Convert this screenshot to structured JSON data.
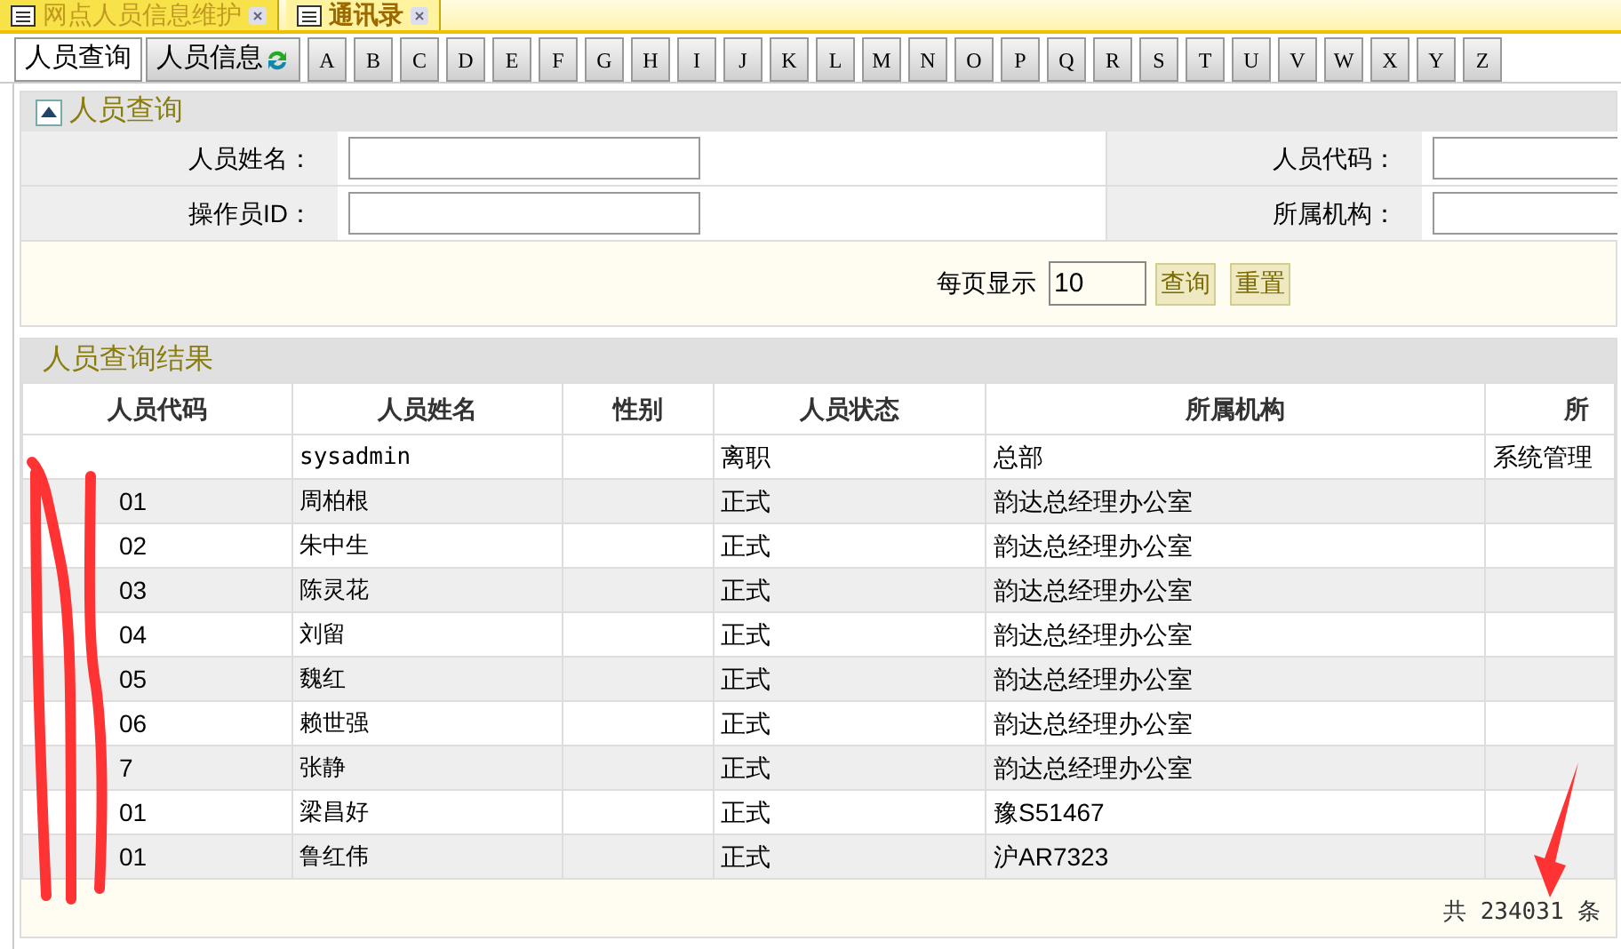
{
  "top_tabs": [
    {
      "label": "网点人员信息维护",
      "selected": false
    },
    {
      "label": "通讯录",
      "selected": true
    }
  ],
  "sub_tabs": [
    {
      "label": "人员查询",
      "selected": true,
      "kind": "text"
    },
    {
      "label": "人员信息",
      "selected": false,
      "kind": "refresh"
    }
  ],
  "letters": [
    "A",
    "B",
    "C",
    "D",
    "E",
    "F",
    "G",
    "H",
    "I",
    "J",
    "K",
    "L",
    "M",
    "N",
    "O",
    "P",
    "Q",
    "R",
    "S",
    "T",
    "U",
    "V",
    "W",
    "X",
    "Y",
    "Z"
  ],
  "query_panel": {
    "title": "人员查询",
    "fields": [
      {
        "label": "人员姓名："
      },
      {
        "label": "人员代码："
      },
      {
        "label": "操作员ID："
      },
      {
        "label": "所属机构："
      }
    ],
    "page_size_label": "每页显示",
    "page_size": "10",
    "buttons": [
      "查询",
      "重置"
    ]
  },
  "results": {
    "title": "人员查询结果",
    "columns": [
      "人员代码",
      "人员姓名",
      "性别",
      "人员状态",
      "所属机构",
      "所"
    ],
    "rows": [
      [
        "",
        "sysadmin",
        "",
        "离职",
        "总部",
        "系统管理"
      ],
      [
        "01",
        "周柏根",
        "",
        "正式",
        "韵达总经理办公室",
        ""
      ],
      [
        "02",
        "朱中生",
        "",
        "正式",
        "韵达总经理办公室",
        ""
      ],
      [
        "03",
        "陈灵花",
        "",
        "正式",
        "韵达总经理办公室",
        ""
      ],
      [
        "04",
        "刘留",
        "",
        "正式",
        "韵达总经理办公室",
        ""
      ],
      [
        "05",
        "魏红",
        "",
        "正式",
        "韵达总经理办公室",
        ""
      ],
      [
        "06",
        "赖世强",
        "",
        "正式",
        "韵达总经理办公室",
        ""
      ],
      [
        "7",
        "张静",
        "",
        "正式",
        "韵达总经理办公室",
        ""
      ],
      [
        "01",
        "梁昌好",
        "",
        "正式",
        "豫S51467",
        ""
      ],
      [
        "01",
        "鲁红伟",
        "",
        "正式",
        "沪AR7323",
        ""
      ]
    ],
    "total": "共 234031 条"
  }
}
